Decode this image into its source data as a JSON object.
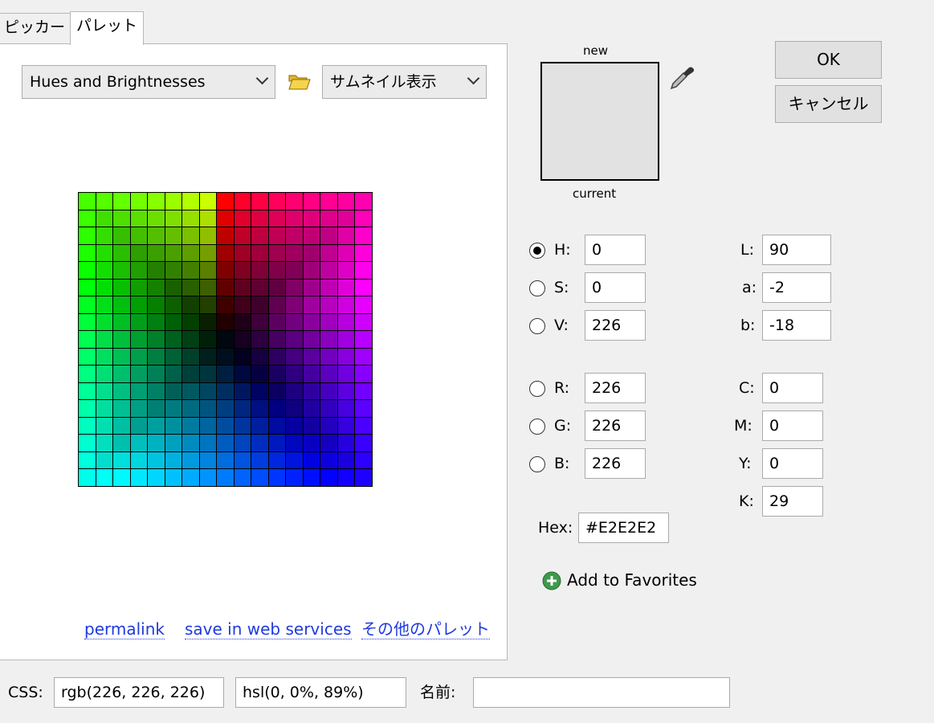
{
  "tabs": [
    {
      "label": "ピッカー"
    },
    {
      "label": "パレット"
    }
  ],
  "palette": {
    "name": "Hues and Brightnesses",
    "view_mode": "サムネイル表示"
  },
  "links": {
    "permalink": "permalink",
    "save": "save in web services",
    "other": "その他のパレット"
  },
  "preview": {
    "new_label": "new",
    "current_label": "current",
    "color": "#E2E2E2"
  },
  "buttons": {
    "ok": "OK",
    "cancel": "キャンセル"
  },
  "hsv": {
    "h": {
      "label": "H:",
      "value": "0",
      "selected": true
    },
    "s": {
      "label": "S:",
      "value": "0"
    },
    "v": {
      "label": "V:",
      "value": "226"
    }
  },
  "lab": {
    "l": {
      "label": "L:",
      "value": "90"
    },
    "a": {
      "label": "a:",
      "value": "-2"
    },
    "b": {
      "label": "b:",
      "value": "-18"
    }
  },
  "rgb": {
    "r": {
      "label": "R:",
      "value": "226"
    },
    "g": {
      "label": "G:",
      "value": "226"
    },
    "b": {
      "label": "B:",
      "value": "226"
    }
  },
  "cmyk": {
    "c": {
      "label": "C:",
      "value": "0"
    },
    "m": {
      "label": "M:",
      "value": "0"
    },
    "y": {
      "label": "Y:",
      "value": "0"
    },
    "k": {
      "label": "K:",
      "value": "29"
    }
  },
  "hex": {
    "label": "Hex:",
    "value": "#E2E2E2"
  },
  "favorites": {
    "label": "Add to Favorites"
  },
  "css": {
    "label": "CSS:",
    "rgb": "rgb(226, 226, 226)",
    "hsl": "hsl(0, 0%, 89%)",
    "name_label": "名前:",
    "name_value": ""
  },
  "icons": {
    "folder": "folder-open-icon",
    "eyedropper": "eyedropper-icon",
    "add": "plus-circle-icon"
  }
}
